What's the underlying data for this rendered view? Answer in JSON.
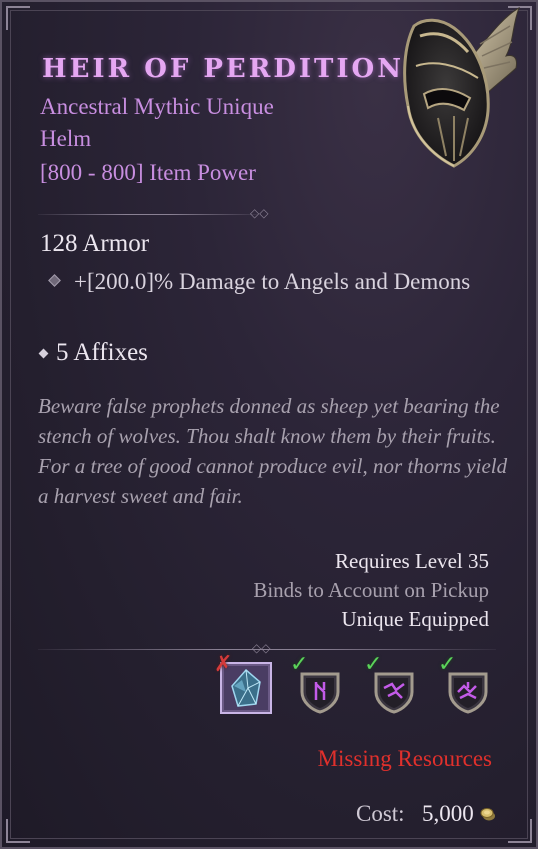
{
  "item": {
    "name": "HEIR OF PERDITION",
    "rarity_line": "Ancestral Mythic Unique",
    "type_line": "Helm",
    "power_line": "[800 - 800] Item Power",
    "armor": "128 Armor",
    "implicit_affix": "+[200.0]% Damage to Angels and Demons",
    "affix_count": "5 Affixes",
    "flavor_text": "Beware false prophets donned as sheep yet bearing the stench of wolves. Thou shalt know them by their fruits. For a tree of good cannot produce evil, nor thorns yield a harvest sweet and fair.",
    "requirements": {
      "level": "Requires Level 35",
      "binding": "Binds to Account on Pickup",
      "equip_rule": "Unique Equipped"
    }
  },
  "resources": [
    {
      "name": "stygian-stone-icon",
      "status": "missing"
    },
    {
      "name": "rune-shield-icon",
      "status": "owned"
    },
    {
      "name": "rune-shield-icon",
      "status": "owned"
    },
    {
      "name": "rune-shield-icon",
      "status": "owned"
    }
  ],
  "status_text": "Missing Resources",
  "cost": {
    "label": "Cost:",
    "value": "5,000",
    "currency_icon": "gold-coin-icon"
  },
  "colors": {
    "title": "#e5a7f2",
    "rarity": "#c88ee0",
    "missing": "#e0302c",
    "check": "#5bd35a",
    "cross": "#d43a3a"
  }
}
